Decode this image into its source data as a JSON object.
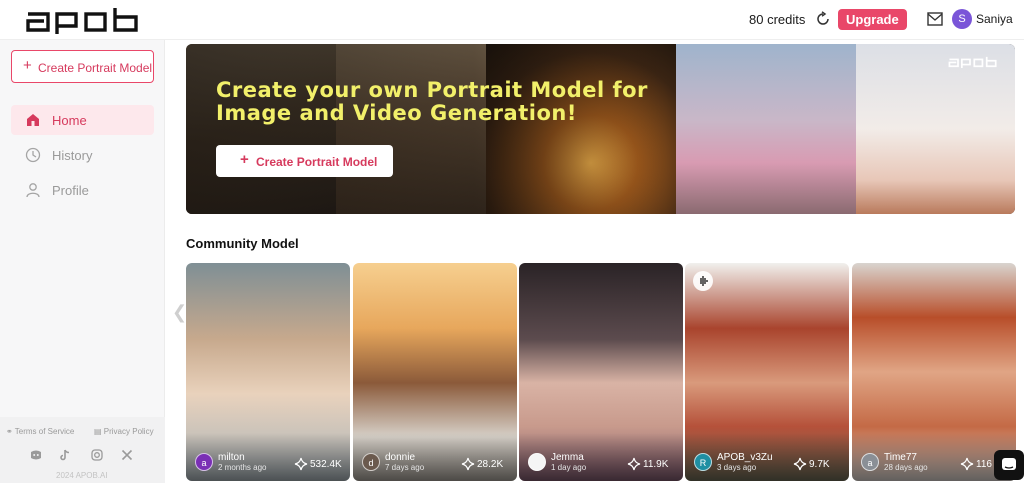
{
  "header": {
    "logo_text": "apob",
    "credits": "80 credits",
    "upgrade_label": "Upgrade",
    "user_initial": "S",
    "user_name": "Saniya"
  },
  "sidebar": {
    "create_label": "Create Portrait Model",
    "items": [
      {
        "label": "Home",
        "icon": "home-icon",
        "active": true
      },
      {
        "label": "History",
        "icon": "clock-icon",
        "active": false
      },
      {
        "label": "Profile",
        "icon": "user-icon",
        "active": false
      }
    ],
    "footer": {
      "terms": "Terms of Service",
      "privacy": "Privacy Policy",
      "social": [
        "discord-icon",
        "tiktok-icon",
        "instagram-icon",
        "x-icon"
      ],
      "copyright": "2024 APOB.AI"
    }
  },
  "banner": {
    "title": "Create your own Portrait Model for Image and Video Generation!",
    "button_label": "Create Portrait Model",
    "logo_text": "apob"
  },
  "community": {
    "title": "Community Model",
    "cards": [
      {
        "initial": "a",
        "name": "milton",
        "time": "2 months ago",
        "count": "532.4K",
        "avatar_color": "#7a2fb5"
      },
      {
        "initial": "d",
        "name": "donnie",
        "time": "7 days ago",
        "count": "28.2K",
        "avatar_color": "#6b5a4e"
      },
      {
        "initial": "",
        "name": "Jemma",
        "time": "1 day ago",
        "count": "11.9K",
        "avatar_color": "#f5f5f5"
      },
      {
        "initial": "R",
        "name": "APOB_v3Zu",
        "time": "3 days ago",
        "count": "9.7K",
        "avatar_color": "#1f8fa3"
      },
      {
        "initial": "a",
        "name": "Time77",
        "time": "28 days ago",
        "count": "116",
        "avatar_color": "#8a8f96"
      }
    ]
  },
  "colors": {
    "accent": "#e94769",
    "banner_title": "#f2f06a"
  }
}
